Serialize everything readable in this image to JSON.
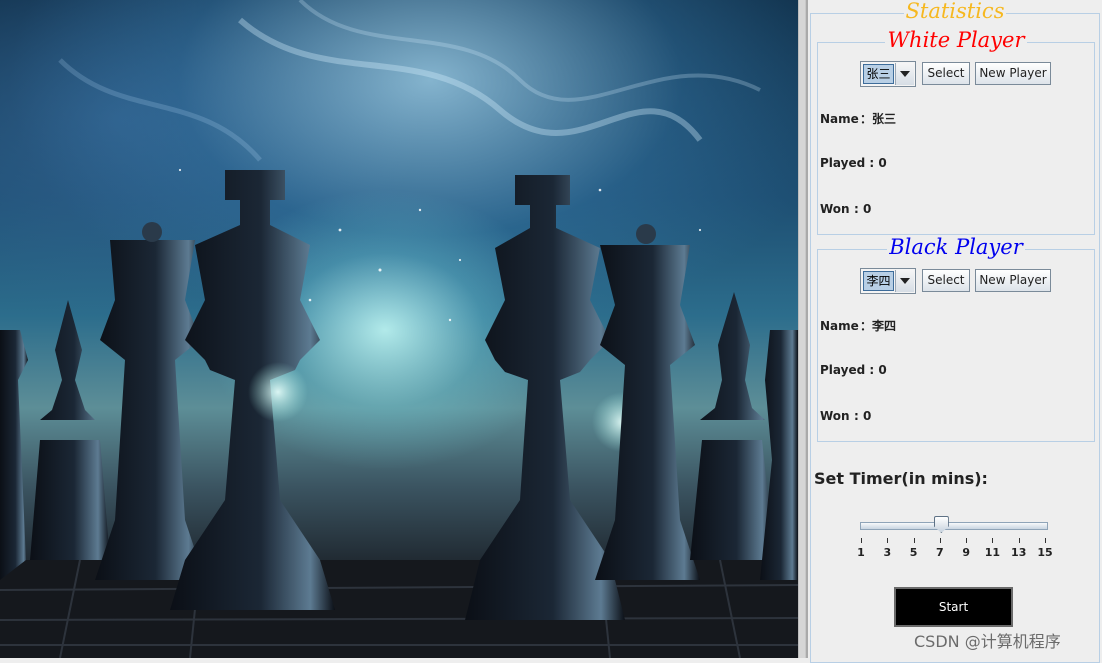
{
  "stats_title": "Statistics",
  "white": {
    "heading": "White Player",
    "selected": "张三",
    "select_label": "Select",
    "new_label": "New Player",
    "name_key": "Name",
    "name_val": "：张三",
    "played_key": "Played",
    "played_val": ": 0",
    "won_key": "Won",
    "won_val": ":  0"
  },
  "black": {
    "heading": "Black Player",
    "selected": "李四",
    "select_label": "Select",
    "new_label": "New Player",
    "name_key": "Name",
    "name_val": "：李四",
    "played_key": "Played",
    "played_val": ": 0",
    "won_key": "Won",
    "won_val": ":  0"
  },
  "timer": {
    "label": "Set Timer(in mins):",
    "value": 7,
    "min": 1,
    "max": 15,
    "ticks": [
      "1",
      "3",
      "5",
      "7",
      "9",
      "11",
      "13",
      "15"
    ]
  },
  "start_label": "Start",
  "watermark": "CSDN @计算机程序",
  "colors": {
    "white_heading": "#ff0000",
    "black_heading": "#0000ee",
    "stats_title": "#f6b820"
  }
}
